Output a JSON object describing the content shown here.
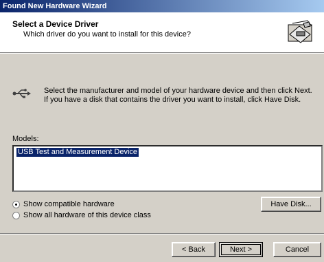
{
  "window": {
    "title": "Found New Hardware Wizard"
  },
  "header": {
    "title": "Select a Device Driver",
    "subtitle": "Which driver do you want to install for this device?",
    "icon": "hardware-driver-icon"
  },
  "instructions": {
    "icon": "usb-icon",
    "text": "Select the manufacturer and model of your hardware device and then click Next. If you have a disk that contains the driver you want to install, click Have Disk."
  },
  "models": {
    "label": "Models:",
    "items": [
      "USB Test and Measurement Device"
    ],
    "selected_index": 0
  },
  "options": {
    "show_compatible": "Show compatible hardware",
    "show_all": "Show all hardware of this device class",
    "selected": "show_compatible"
  },
  "buttons": {
    "have_disk": "Have Disk...",
    "back": "< Back",
    "next": "Next >",
    "cancel": "Cancel"
  }
}
